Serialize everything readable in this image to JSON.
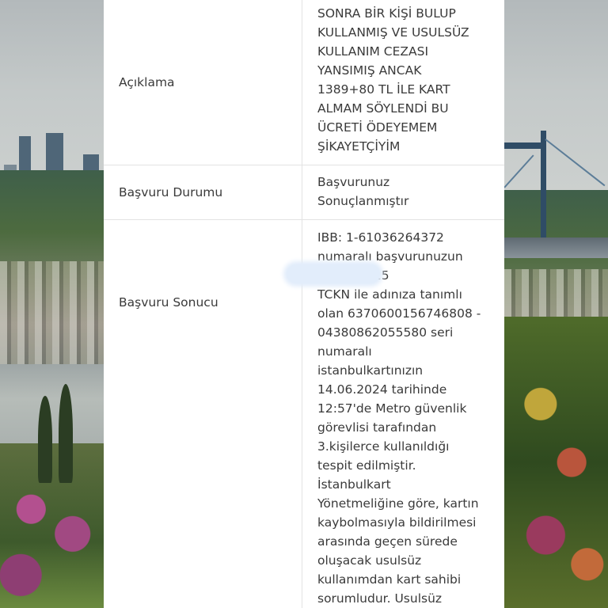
{
  "table": {
    "rows": [
      {
        "label": "Açıklama",
        "value": "SONRA BİR KİŞİ BULUP\nKULLANMIŞ VE USULSÜZ\nKULLANIM CEZASI\nYANSIMIŞ ANCAK\n1389+80 TL İLE KART\nALMAM SÖYLENDİ BU\nÜCRETİ ÖDEYEMEM\nŞİKAYETÇİYİM"
      },
      {
        "label": "Başvuru Durumu",
        "value": "Başvurunuz\nSonuçlanmıştır"
      },
      {
        "label": "Başvuru Sonucu",
        "value": "IBB: 1-61036264372\nnumaralı başvurunuzun\ncevabı: 215\nTCKN ile adınıza tanımlı\nolan 6370600156746808 -\n04380862055580 seri\nnumaralı\nistanbulkartınızın\n14.06.2024 tarihinde\n12:57'de Metro güvenlik\ngörevlisi tarafından\n3.kişilerce kullanıldığı\ntespit edilmiştir.\nİstanbulkart\nYönetmeliğine göre, kartın\nkaybolmasıyla bildirilmesi\narasında geçen sürede\noluşacak usulsüz\nkullanımdan kart sahibi\nsorumludur. Usulsüz"
      }
    ]
  }
}
